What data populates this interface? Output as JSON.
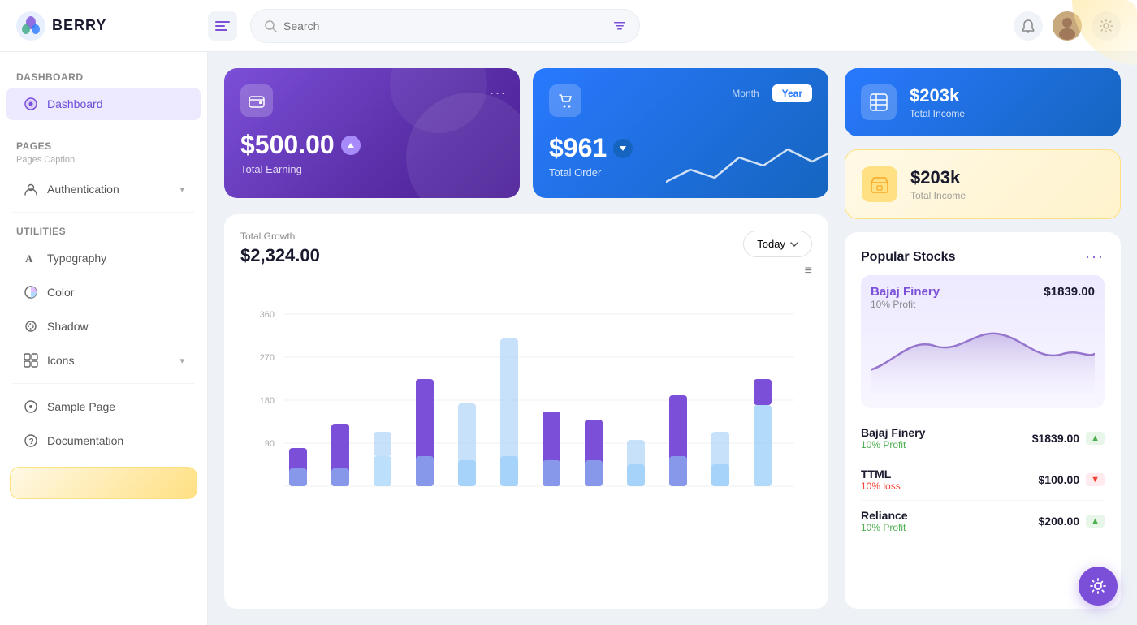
{
  "app": {
    "logo_text": "BERRY",
    "search_placeholder": "Search"
  },
  "sidebar": {
    "section_dashboard": "Dashboard",
    "item_dashboard": "Dashboard",
    "section_pages": "Pages",
    "pages_caption": "Pages Caption",
    "item_authentication": "Authentication",
    "section_utilities": "Utilities",
    "item_typography": "Typography",
    "item_color": "Color",
    "item_shadow": "Shadow",
    "item_icons": "Icons",
    "item_sample_page": "Sample Page",
    "item_documentation": "Documentation"
  },
  "card1": {
    "amount": "$500.00",
    "label": "Total Earning",
    "more": "..."
  },
  "card2": {
    "tab_month": "Month",
    "tab_year": "Year",
    "amount": "$961",
    "label": "Total Order"
  },
  "card3": {
    "value": "$203k",
    "label": "Total Income"
  },
  "card4": {
    "value": "$203k",
    "label": "Total Income"
  },
  "chart": {
    "title": "Total Growth",
    "value": "$2,324.00",
    "btn_label": "Today",
    "y_labels": [
      "360",
      "270",
      "180",
      "90"
    ]
  },
  "stocks": {
    "title": "Popular Stocks",
    "featured_name": "Bajaj Finery",
    "featured_value": "$1839.00",
    "featured_profit": "10% Profit",
    "items": [
      {
        "name": "Bajaj Finery",
        "price": "$1839.00",
        "status": "profit",
        "status_text": "10% Profit",
        "direction": "up"
      },
      {
        "name": "TTML",
        "price": "$100.00",
        "status": "loss",
        "status_text": "10% loss",
        "direction": "down"
      },
      {
        "name": "Reliance",
        "price": "$200.00",
        "status": "profit",
        "status_text": "10% Profit",
        "direction": "up"
      }
    ]
  }
}
